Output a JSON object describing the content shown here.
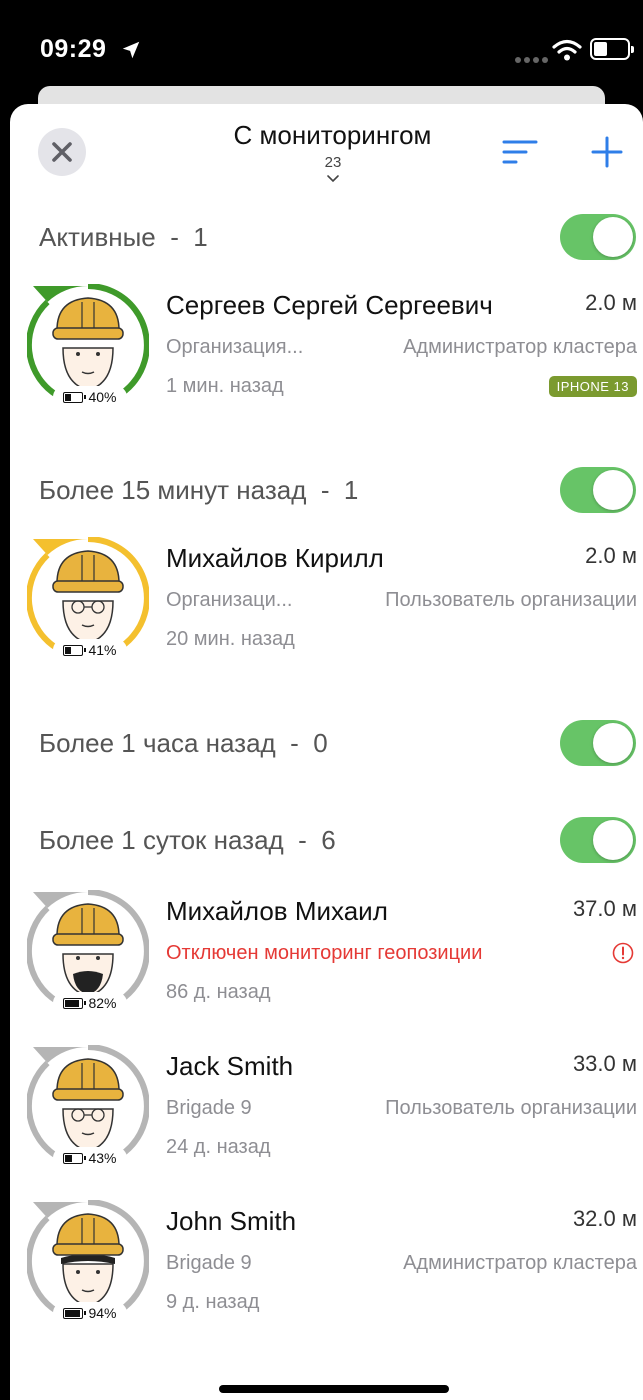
{
  "status": {
    "time": "09:29"
  },
  "header": {
    "title": "С мониторингом",
    "count": "23"
  },
  "colors": {
    "accent": "#2f7ee8",
    "active": "#3f9a2a",
    "stale": "#f4c02e",
    "offline": "#b5b5b5",
    "toggle_on": "#67c467"
  },
  "sections": [
    {
      "label": "Активные  -  1",
      "enabled": true
    },
    {
      "label": "Более 15 минут назад  -  1",
      "enabled": true
    },
    {
      "label": "Более 1 часа назад  -  0",
      "enabled": true
    },
    {
      "label": "Более 1 суток назад  -  6",
      "enabled": true
    }
  ],
  "people": [
    {
      "name": "Сергеев Сергей Сергеевич",
      "distance": "2.0 м",
      "org": "Организация...",
      "role": "Администратор кластера",
      "ago": "1 мин. назад",
      "device": "IPHONE 13",
      "battery": "40%",
      "battery_level": 0.4,
      "status_color": "#3f9a2a",
      "icon": "worker-avatar-icon"
    },
    {
      "name": "Михайлов Кирилл",
      "distance": "2.0 м",
      "org": "Организаци...",
      "role": "Пользователь организации",
      "ago": "20 мин. назад",
      "battery": "41%",
      "battery_level": 0.41,
      "status_color": "#f4c02e",
      "icon": "worker-glasses-avatar-icon"
    },
    {
      "name": "Михайлов Михаил",
      "distance": "37.0 м",
      "warning": "Отключен мониторинг геопозиции",
      "ago": "86 д. назад",
      "battery": "82%",
      "battery_level": 0.82,
      "status_color": "#b5b5b5",
      "icon": "worker-beard-avatar-icon"
    },
    {
      "name": "Jack Smith",
      "distance": "33.0 м",
      "org": "Brigade 9",
      "role": "Пользователь организации",
      "ago": "24 д. назад",
      "battery": "43%",
      "battery_level": 0.43,
      "status_color": "#b5b5b5",
      "icon": "worker-glasses-avatar-icon"
    },
    {
      "name": "John Smith",
      "distance": "32.0 м",
      "org": "Brigade 9",
      "role": "Администратор кластера",
      "ago": "9 д. назад",
      "battery": "94%",
      "battery_level": 0.94,
      "status_color": "#b5b5b5",
      "icon": "worker-hair-avatar-icon"
    }
  ]
}
